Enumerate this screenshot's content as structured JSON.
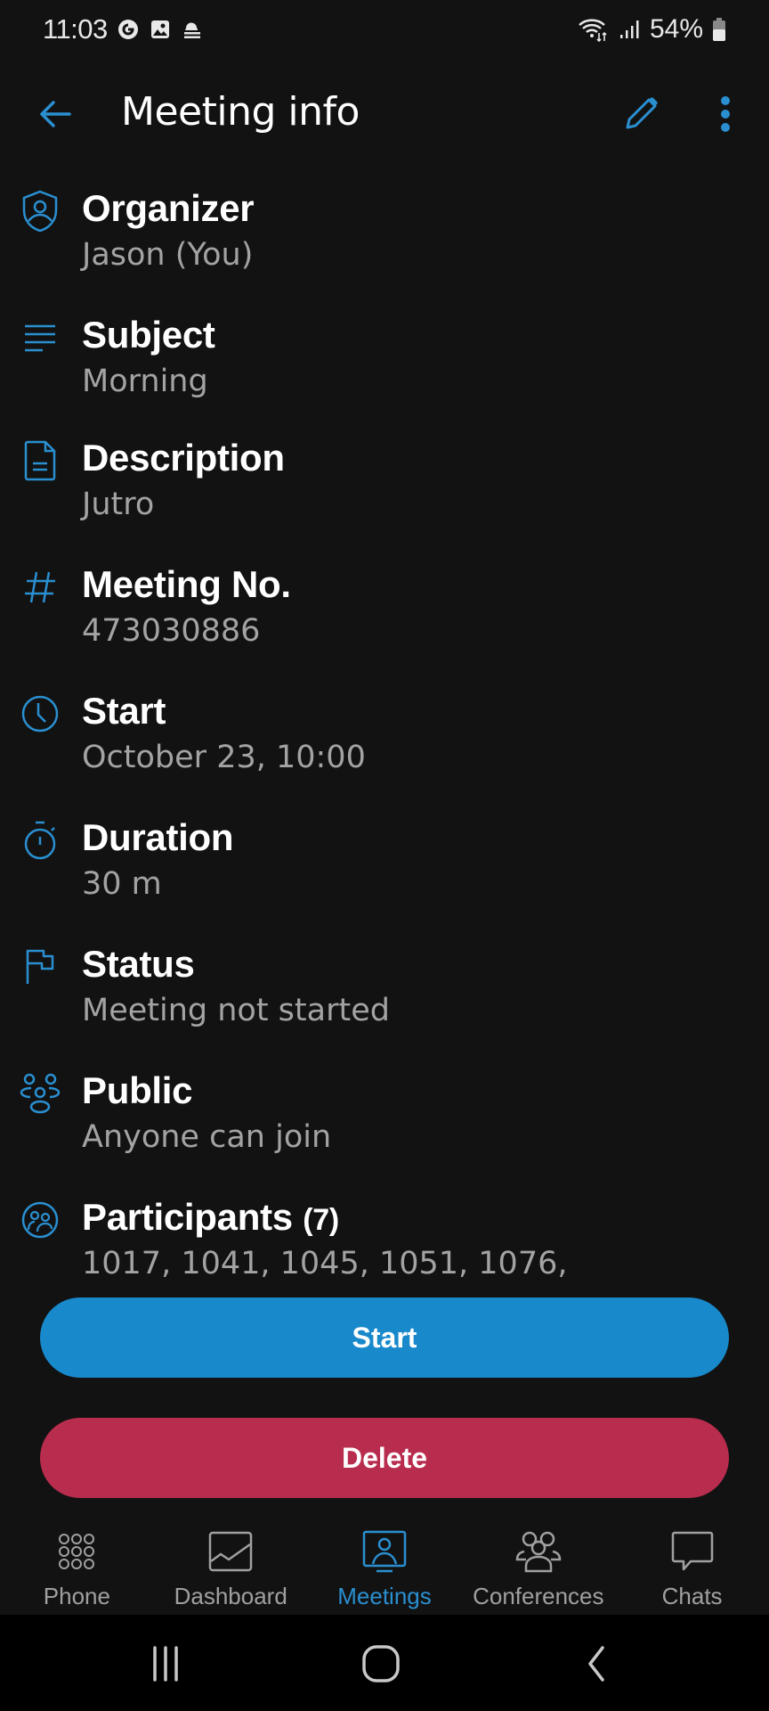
{
  "status_bar": {
    "time": "11:03",
    "notification_icons": [
      "g-icon",
      "gallery-icon",
      "weather-icon"
    ],
    "battery": "54%"
  },
  "app_bar": {
    "title": "Meeting info"
  },
  "colors": {
    "accent": "#1889cb",
    "danger": "#b82c4e",
    "background": "#121212",
    "secondary_text": "#a3a3a3"
  },
  "info": [
    {
      "label": "Organizer",
      "value": "Jason (You)",
      "icon": "organizer-shield-icon"
    },
    {
      "label": "Subject",
      "value": "Morning",
      "icon": "subject-lines-icon"
    },
    {
      "label": "Description",
      "value": "Jutro",
      "icon": "document-icon"
    },
    {
      "label": "Meeting No.",
      "value": "473030886",
      "icon": "hash-icon"
    },
    {
      "label": "Start",
      "value": "October 23, 10:00",
      "icon": "clock-icon"
    },
    {
      "label": "Duration",
      "value": "30 m",
      "icon": "stopwatch-icon"
    },
    {
      "label": "Status",
      "value": "Meeting not started",
      "icon": "flag-icon"
    },
    {
      "label": "Public",
      "value": "Anyone can join",
      "icon": "group-icon"
    },
    {
      "label": "Participants",
      "count": "(7)",
      "value": "1017, 1041, 1045, 1051, 1076,",
      "icon": "participants-icon"
    }
  ],
  "buttons": {
    "start": "Start",
    "delete": "Delete"
  },
  "bottom_nav": [
    {
      "label": "Phone",
      "active": false
    },
    {
      "label": "Dashboard",
      "active": false
    },
    {
      "label": "Meetings",
      "active": true
    },
    {
      "label": "Conferences",
      "active": false
    },
    {
      "label": "Chats",
      "active": false
    }
  ]
}
